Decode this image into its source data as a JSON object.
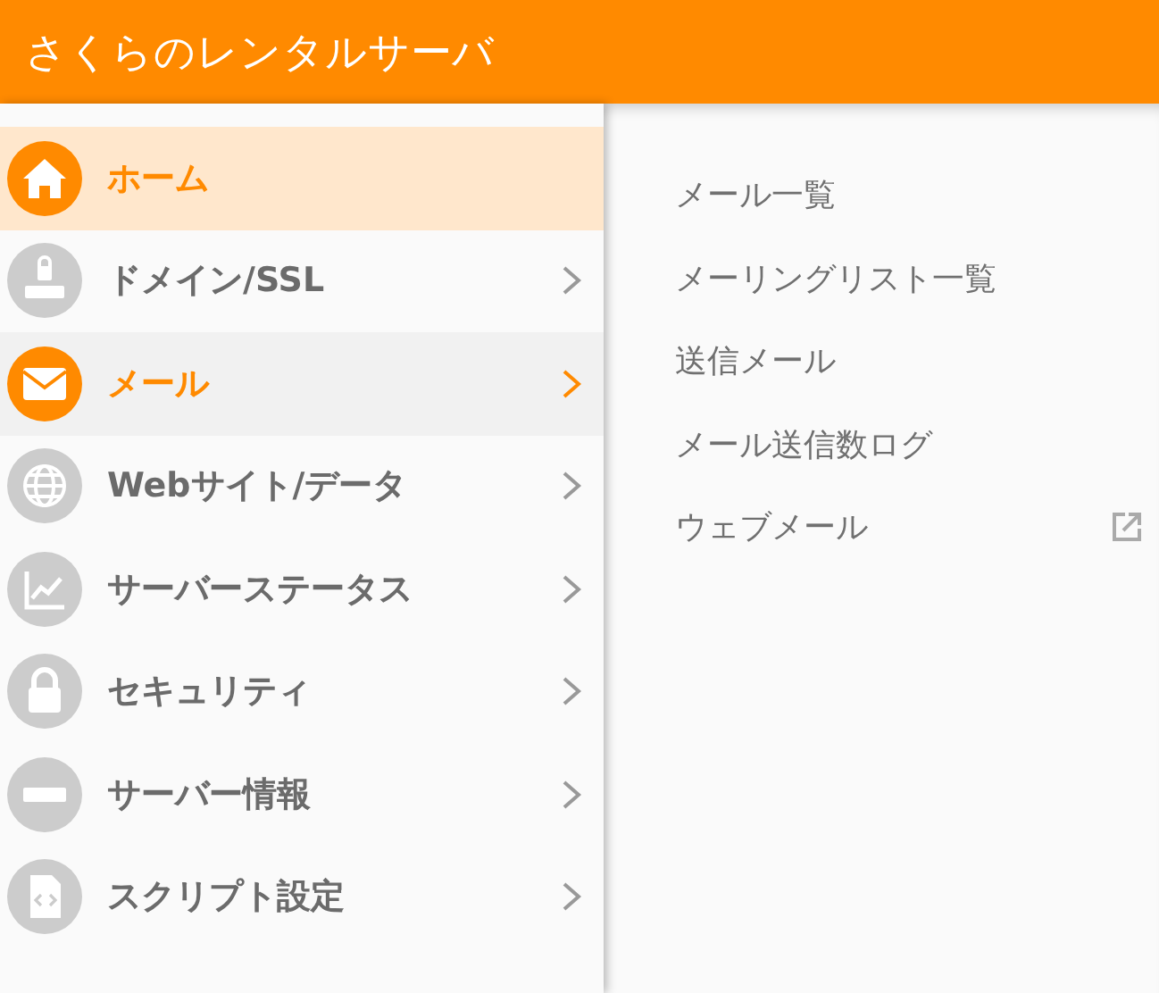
{
  "header": {
    "title": "さくらのレンタルサーバ"
  },
  "sidebar": {
    "items": [
      {
        "label": "ホーム",
        "kind": "page",
        "current": true,
        "expanded": false
      },
      {
        "label": "ドメイン/SSL",
        "kind": "group",
        "current": false,
        "expanded": false
      },
      {
        "label": "メール",
        "kind": "group",
        "current": false,
        "expanded": true
      },
      {
        "label": "Webサイト/データ",
        "kind": "group",
        "current": false,
        "expanded": false
      },
      {
        "label": "サーバーステータス",
        "kind": "group",
        "current": false,
        "expanded": false
      },
      {
        "label": "セキュリティ",
        "kind": "group",
        "current": false,
        "expanded": false
      },
      {
        "label": "サーバー情報",
        "kind": "group",
        "current": false,
        "expanded": false
      },
      {
        "label": "スクリプト設定",
        "kind": "group",
        "current": false,
        "expanded": false
      }
    ]
  },
  "submenu": {
    "items": [
      {
        "label": "メール一覧",
        "external": false
      },
      {
        "label": "メーリングリスト一覧",
        "external": false
      },
      {
        "label": "送信メール",
        "external": false
      },
      {
        "label": "メール送信数ログ",
        "external": false
      },
      {
        "label": "ウェブメール",
        "external": true
      }
    ]
  }
}
